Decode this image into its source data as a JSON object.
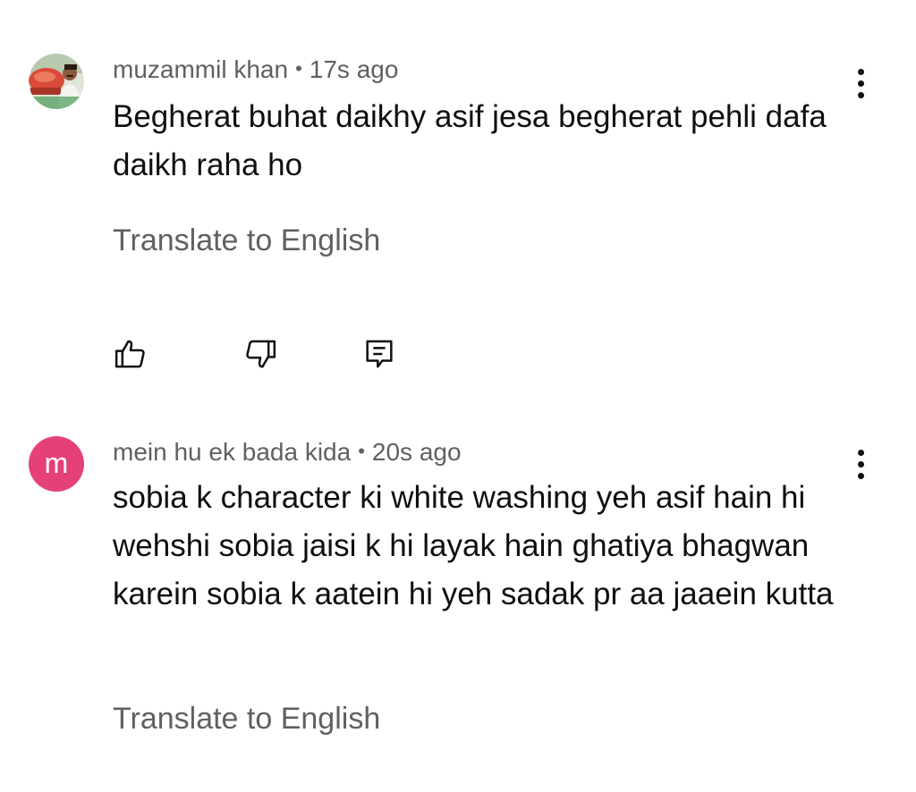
{
  "comments": [
    {
      "author": "muzammil khan",
      "separator": "•",
      "time": "17s ago",
      "text": "Begherat buhat daikhy asif jesa begherat pehli dafa daikh raha ho",
      "translate_label": "Translate to English",
      "avatar_type": "photo"
    },
    {
      "author": "mein hu ek bada kida",
      "separator": "•",
      "time": "20s ago",
      "text": "sobia k character ki white washing yeh asif hain hi wehshi sobia jaisi k hi layak hain ghatiya bhagwan karein sobia k aatein hi yeh sadak pr aa jaaein kutta",
      "translate_label": "Translate to English",
      "avatar_letter": "m",
      "avatar_color": "#e6407a"
    }
  ],
  "actions": {
    "like_icon": "thumbs-up-icon",
    "dislike_icon": "thumbs-down-icon",
    "reply_icon": "reply-comment-icon"
  },
  "colors": {
    "text_primary": "#0f0f0f",
    "text_secondary": "#606060",
    "background": "#ffffff"
  }
}
